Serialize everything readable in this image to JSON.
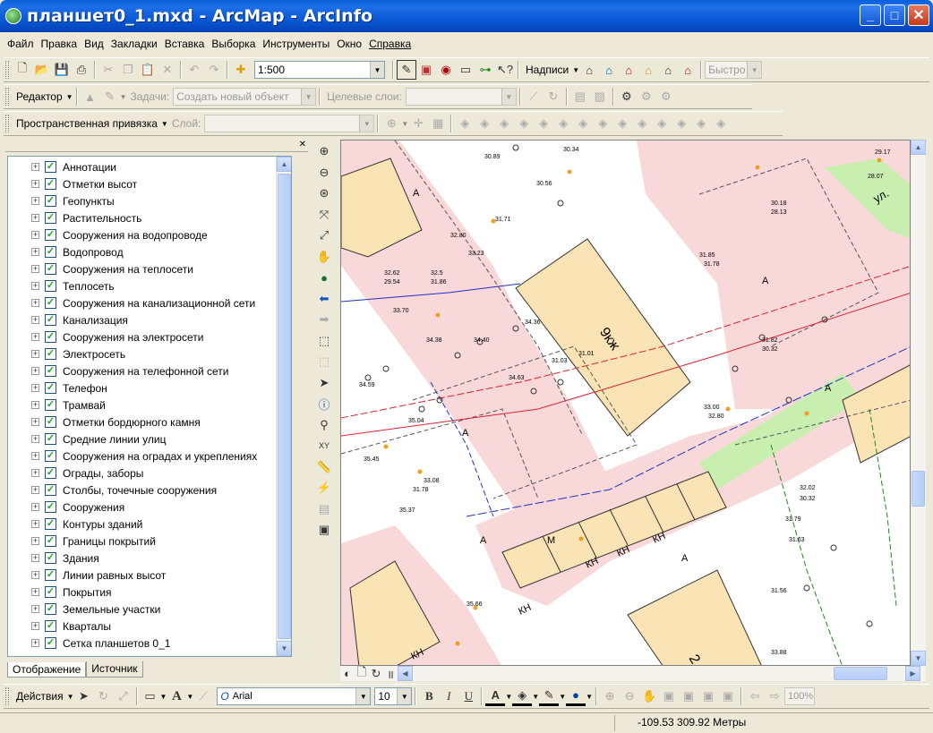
{
  "window": {
    "title": "планшет0_1.mxd - ArcMap - ArcInfo"
  },
  "menu": [
    "Файл",
    "Правка",
    "Вид",
    "Закладки",
    "Вставка",
    "Выборка",
    "Инструменты",
    "Окно",
    "Справка"
  ],
  "toolbar_main": {
    "scale": "1:500",
    "labels_menu": "Надписи",
    "quick_combo": "Быстро"
  },
  "toolbar_editor": {
    "editor_menu": "Редактор",
    "task_label": "Задачи:",
    "task_value": "Создать новый объект",
    "target_label": "Целевые слои:"
  },
  "toolbar_snap": {
    "snap_menu": "Пространственная привязка",
    "layer_label": "Слой:"
  },
  "toc": {
    "layers": [
      "Аннотации",
      "Отметки высот",
      "Геопункты",
      "Растительность",
      "Сооружения на водопроводе",
      "Водопровод",
      "Сооружения на теплосети",
      "Теплосеть",
      "Сооружения на канализационной сети",
      "Канализация",
      "Сооружения на электросети",
      "Электросеть",
      "Сооружения на телефонной сети",
      "Телефон",
      "Трамвай",
      "Отметки бордюрного камня",
      "Средние линии улиц",
      "Сооружения на оградах и укреплениях",
      "Ограды, заборы",
      "Столбы, точечные сооружения",
      "Сооружения",
      "Контуры зданий",
      "Границы покрытий",
      "Здания",
      "Линии равных высот",
      "Покрытия",
      "Земельные участки",
      "Кварталы",
      "Сетка планшетов 0_1"
    ],
    "tabs": [
      "Отображение",
      "Источник"
    ]
  },
  "map": {
    "building_label": "9кж",
    "building_label_2": "2",
    "zone_label": "А",
    "kn_label": "КН",
    "m_label": "М",
    "street_label": "ул.",
    "elevations": [
      "30.34",
      "30.89",
      "30.56",
      "31.71",
      "32.80",
      "33.23",
      "32.62",
      "32.5",
      "29.54",
      "31.86",
      "33.70",
      "34.38",
      "34.40",
      "34.36",
      "34.59",
      "35.04",
      "35.45",
      "33.08",
      "31.78",
      "35.37",
      "31.85",
      "31.78",
      "30.18",
      "28.13",
      "31.82",
      "30.32",
      "33.00",
      "32.80",
      "31.56",
      "32.02",
      "30.32",
      "31.79",
      "31.63",
      "35.66",
      "33.88",
      "29.17",
      "28.07",
      "31.01",
      "31.03",
      "34.63"
    ]
  },
  "drawing_toolbar": {
    "actions_menu": "Действия",
    "font": "Arial",
    "font_size": "10",
    "bold": "B",
    "italic": "I",
    "underline": "U",
    "zoom_level": "100%"
  },
  "status": {
    "coordinates": "-109.53  309.92 Метры"
  },
  "colors": {
    "title_blue": "#0754d0",
    "road_pink": "#f8d8d8",
    "building": "#fae3b4",
    "green": "#c8efb0"
  }
}
